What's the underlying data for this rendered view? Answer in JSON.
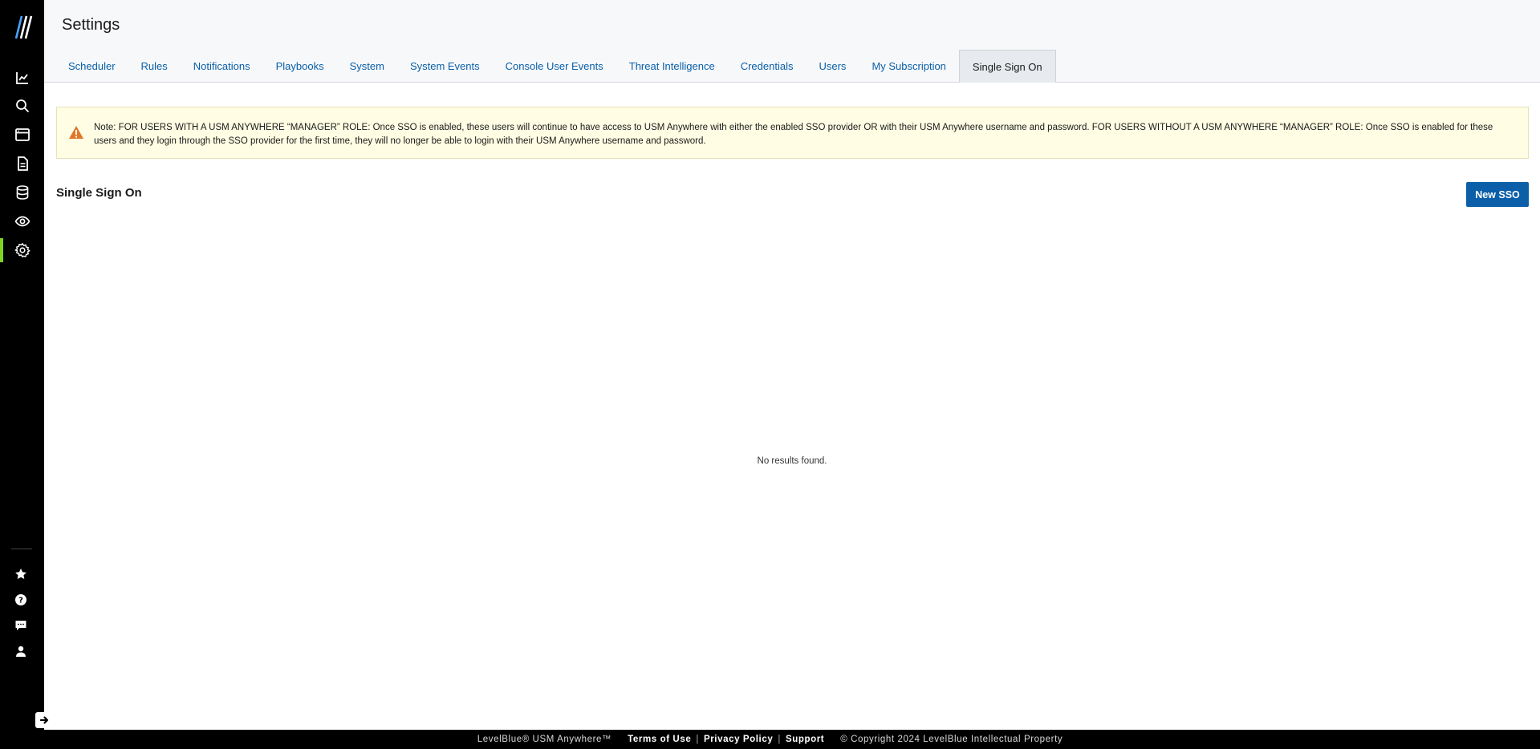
{
  "app": {
    "brand_color": "#0a5fa8",
    "active_accent": "#7ed321"
  },
  "sidebar": {
    "logo": "levelblue-logo",
    "items": [
      {
        "icon": "chart-icon"
      },
      {
        "icon": "search-icon"
      },
      {
        "icon": "window-icon"
      },
      {
        "icon": "document-icon"
      },
      {
        "icon": "database-icon"
      },
      {
        "icon": "eye-icon"
      },
      {
        "icon": "gear-icon",
        "active": true
      }
    ],
    "bottom_items": [
      {
        "icon": "star-icon"
      },
      {
        "icon": "help-icon"
      },
      {
        "icon": "chat-icon"
      },
      {
        "icon": "user-icon"
      }
    ],
    "collapse_icon": "arrow-right-icon"
  },
  "header": {
    "title": "Settings",
    "tabs": [
      {
        "label": "Scheduler"
      },
      {
        "label": "Rules"
      },
      {
        "label": "Notifications"
      },
      {
        "label": "Playbooks"
      },
      {
        "label": "System"
      },
      {
        "label": "System Events"
      },
      {
        "label": "Console User Events"
      },
      {
        "label": "Threat Intelligence"
      },
      {
        "label": "Credentials"
      },
      {
        "label": "Users"
      },
      {
        "label": "My Subscription"
      },
      {
        "label": "Single Sign On",
        "active": true
      }
    ]
  },
  "notice": {
    "icon": "warning-icon",
    "text": "Note: FOR USERS WITH A USM ANYWHERE “MANAGER” ROLE: Once SSO is enabled, these users will continue to have access to USM Anywhere with either the enabled SSO provider OR with their USM Anywhere username and password. FOR USERS WITHOUT A USM ANYWHERE “MANAGER” ROLE: Once SSO is enabled for these users and they login through the SSO provider for the first time, they will no longer be able to login with their USM Anywhere username and password."
  },
  "main": {
    "section_title": "Single Sign On",
    "new_button": "New SSO",
    "empty_text": "No results found."
  },
  "footer": {
    "brand": "LevelBlue® USM Anywhere™",
    "terms": "Terms of Use",
    "separator": "|",
    "privacy": "Privacy Policy",
    "support": "Support",
    "copyright": "© Copyright 2024 LevelBlue Intellectual Property"
  }
}
